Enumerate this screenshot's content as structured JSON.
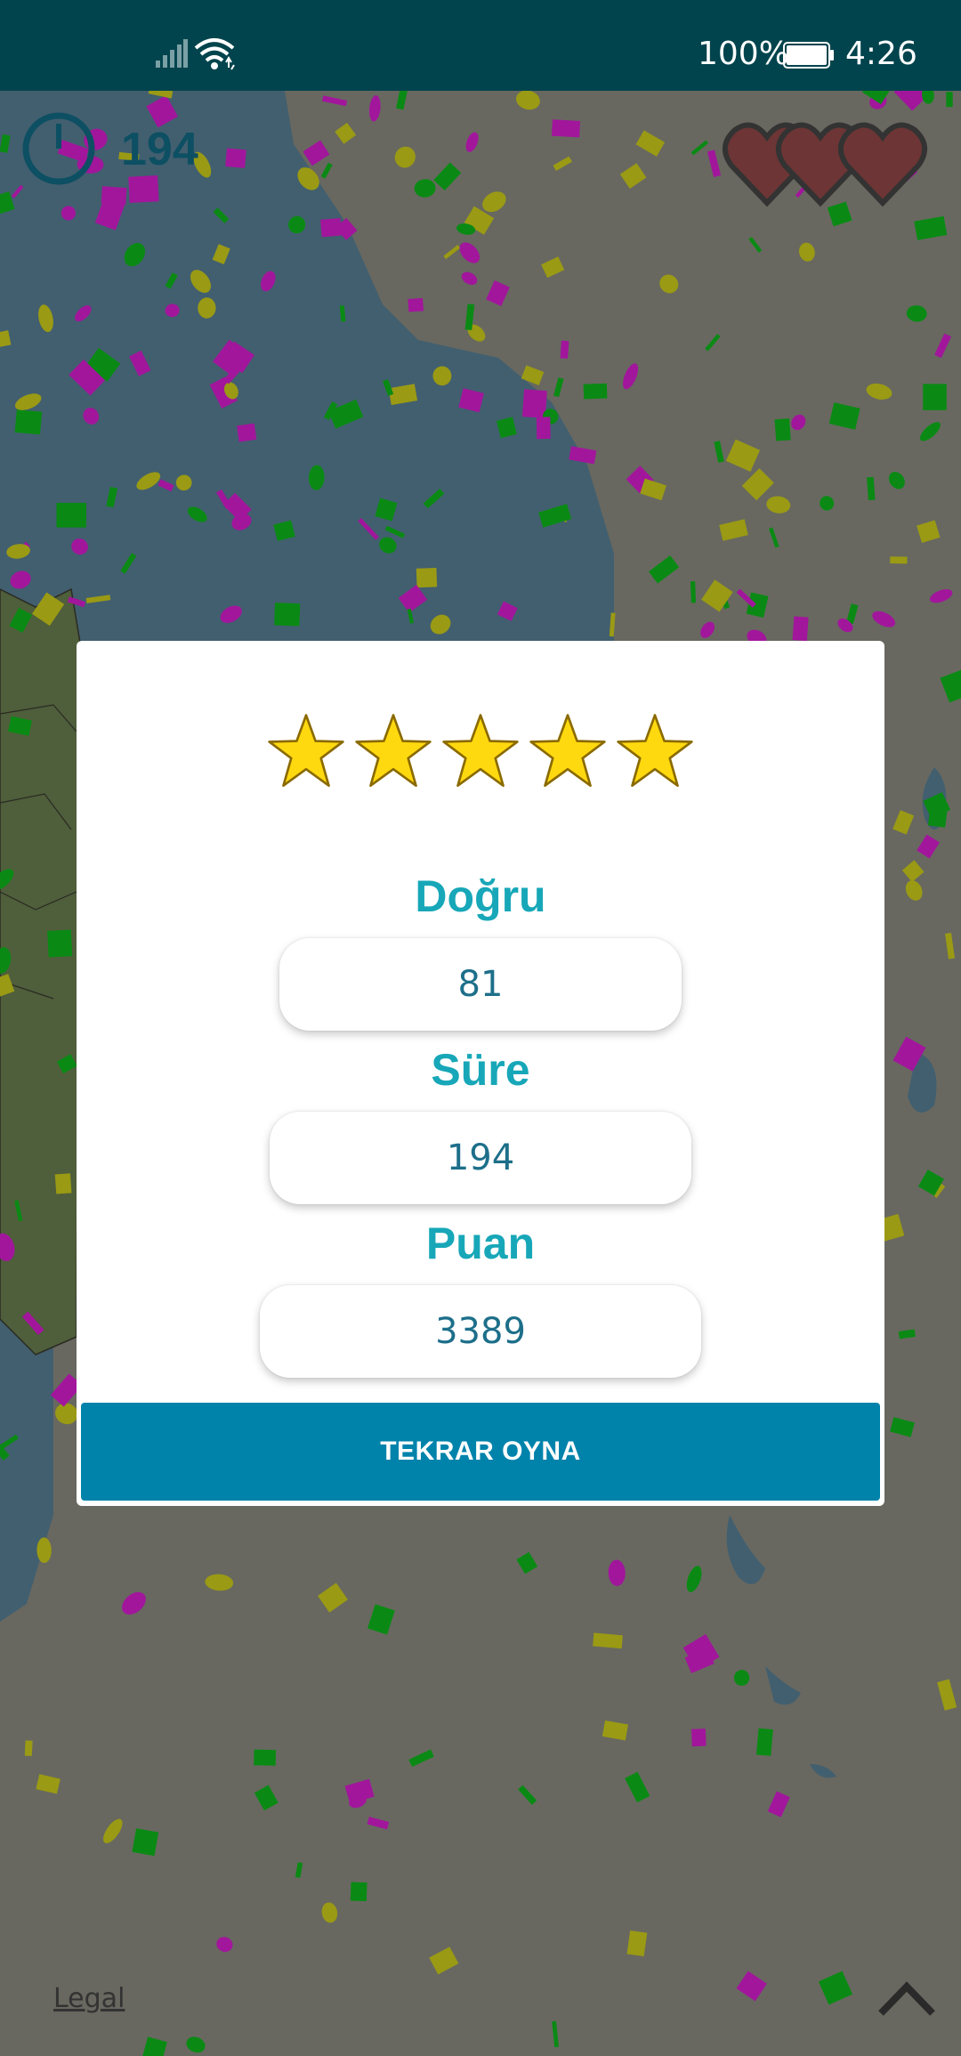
{
  "status_bar": {
    "battery_percent": "100%",
    "time": "4:26",
    "icons": [
      "signal-icon",
      "wifi-icon",
      "battery-icon"
    ]
  },
  "game": {
    "timer_value": "194",
    "lives_icon": "heart-icon",
    "lives_count": 3
  },
  "result_dialog": {
    "stars_count": 5,
    "correct_label": "Doğru",
    "correct_value": "81",
    "time_label": "Süre",
    "time_value": "194",
    "score_label": "Puan",
    "score_value": "3389",
    "play_again_label": "TEKRAR OYNA"
  },
  "footer": {
    "legal_label": "Legal",
    "scroll_top_icon": "chevron-up-icon"
  },
  "colors": {
    "status_bar": "#02444d",
    "accent_label": "#17a7b8",
    "value_text": "#1d6f8a",
    "button": "#0083ab",
    "star_fill": "#ffd90f",
    "confetti_magenta": "#a2169c",
    "confetti_green": "#0a8a14",
    "confetti_yellow": "#9a9a14"
  }
}
